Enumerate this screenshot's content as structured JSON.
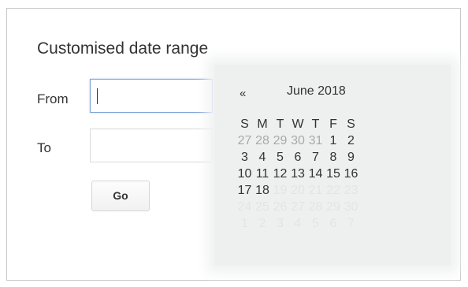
{
  "dialog": {
    "title": "Customised date range",
    "from_label": "From",
    "to_label": "To",
    "from_value": "",
    "to_value": "",
    "go_label": "Go"
  },
  "calendar": {
    "prev_label": "«",
    "month_label": "June 2018",
    "weekdays": [
      "S",
      "M",
      "T",
      "W",
      "T",
      "F",
      "S"
    ],
    "weeks": [
      [
        {
          "d": "27",
          "s": "other"
        },
        {
          "d": "28",
          "s": "other"
        },
        {
          "d": "29",
          "s": "other"
        },
        {
          "d": "30",
          "s": "other"
        },
        {
          "d": "31",
          "s": "other"
        },
        {
          "d": "1",
          "s": "normal"
        },
        {
          "d": "2",
          "s": "normal"
        }
      ],
      [
        {
          "d": "3",
          "s": "normal"
        },
        {
          "d": "4",
          "s": "normal"
        },
        {
          "d": "5",
          "s": "normal"
        },
        {
          "d": "6",
          "s": "normal"
        },
        {
          "d": "7",
          "s": "normal"
        },
        {
          "d": "8",
          "s": "normal"
        },
        {
          "d": "9",
          "s": "normal"
        }
      ],
      [
        {
          "d": "10",
          "s": "normal"
        },
        {
          "d": "11",
          "s": "normal"
        },
        {
          "d": "12",
          "s": "normal"
        },
        {
          "d": "13",
          "s": "normal"
        },
        {
          "d": "14",
          "s": "normal"
        },
        {
          "d": "15",
          "s": "normal"
        },
        {
          "d": "16",
          "s": "normal"
        }
      ],
      [
        {
          "d": "17",
          "s": "normal"
        },
        {
          "d": "18",
          "s": "normal"
        },
        {
          "d": "19",
          "s": "faded"
        },
        {
          "d": "20",
          "s": "faded"
        },
        {
          "d": "21",
          "s": "faded"
        },
        {
          "d": "22",
          "s": "faded"
        },
        {
          "d": "23",
          "s": "faded"
        }
      ],
      [
        {
          "d": "24",
          "s": "faded"
        },
        {
          "d": "25",
          "s": "faded"
        },
        {
          "d": "26",
          "s": "faded"
        },
        {
          "d": "27",
          "s": "faded"
        },
        {
          "d": "28",
          "s": "faded"
        },
        {
          "d": "29",
          "s": "faded"
        },
        {
          "d": "30",
          "s": "faded"
        }
      ],
      [
        {
          "d": "1",
          "s": "faded"
        },
        {
          "d": "2",
          "s": "faded"
        },
        {
          "d": "3",
          "s": "faded"
        },
        {
          "d": "4",
          "s": "faded"
        },
        {
          "d": "5",
          "s": "faded"
        },
        {
          "d": "6",
          "s": "faded"
        },
        {
          "d": "7",
          "s": "faded"
        }
      ]
    ]
  },
  "colors": {
    "text": "#333333",
    "other_month_text": "#a9a9a9",
    "focus_border": "#7ea3d6",
    "calendar_background": "#eef0f0"
  }
}
